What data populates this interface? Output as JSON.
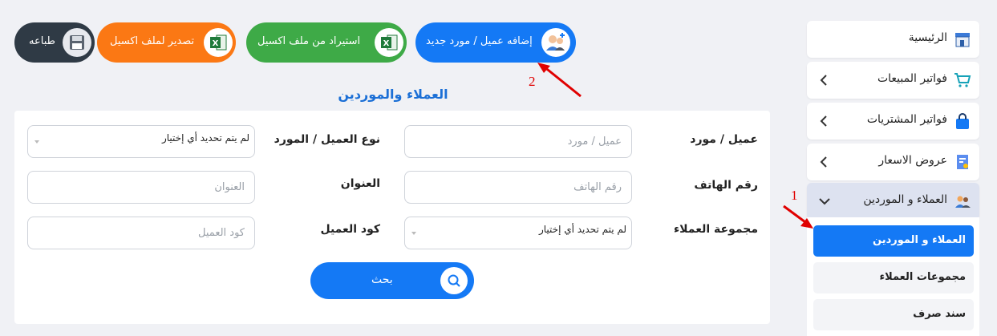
{
  "top_buttons": {
    "add_label": "إضافه عميل / مورد جديد",
    "import_label": "استيراد من ملف اكسيل",
    "export_label": "تصدير لملف اكسيل",
    "print_label": "طباعه"
  },
  "page": {
    "title": "العملاء والموردين"
  },
  "form": {
    "client_label": "عميل / مورد",
    "client_placeholder": "عميل / مورد",
    "type_label": "نوع العميل / المورد",
    "type_value": "لم يتم تحديد أي إختيار",
    "phone_label": "رقم الهاتف",
    "phone_placeholder": "رقم الهاتف",
    "address_label": "العنوان",
    "address_placeholder": "العنوان",
    "group_label": "مجموعة العملاء",
    "group_value": "لم يتم تحديد أي إختيار",
    "code_label": "كود العميل",
    "code_placeholder": "كود العميل",
    "search_label": "بحث"
  },
  "sidebar": {
    "items": [
      {
        "label": "الرئيسية"
      },
      {
        "label": "فواتير المبيعات"
      },
      {
        "label": "فواتير المشتريات"
      },
      {
        "label": "عروض الاسعار"
      },
      {
        "label": "العملاء و الموردين"
      }
    ],
    "sub_items": [
      {
        "label": "العملاء و الموردين"
      },
      {
        "label": "مجموعات العملاء"
      },
      {
        "label": "سند صرف"
      }
    ]
  },
  "annotations": {
    "marker_1": "1",
    "marker_2": "2"
  },
  "colors": {
    "accent_blue": "#1479f5",
    "import_green": "#3eaa47",
    "export_orange": "#fb7814",
    "print_dark": "#2f3a45",
    "annotation_red": "#e00000"
  }
}
